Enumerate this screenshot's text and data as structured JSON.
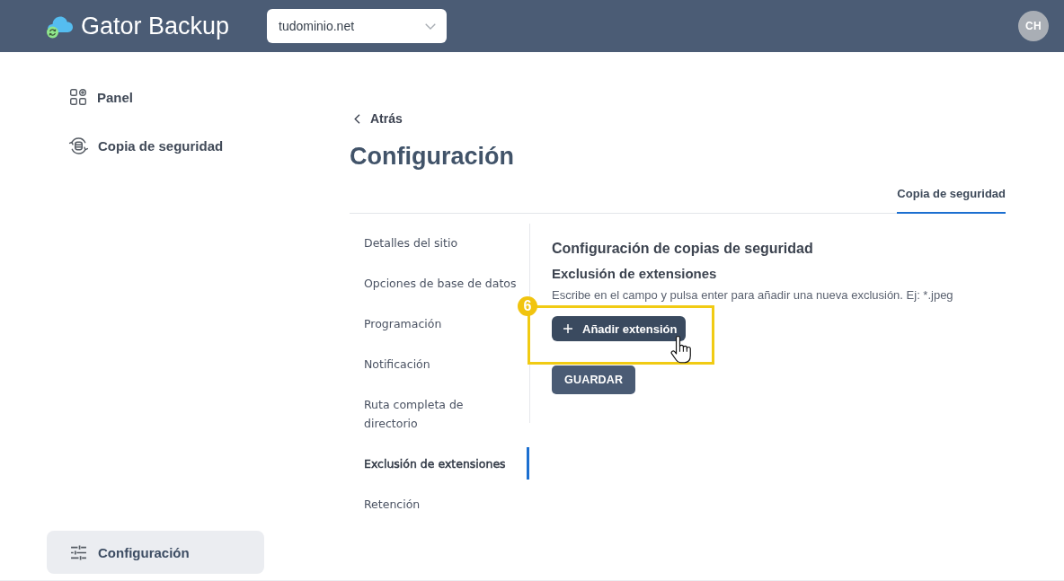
{
  "header": {
    "app_name": "Gator Backup",
    "domain_select": {
      "value": "tudominio.net"
    },
    "avatar": {
      "initials": "CH"
    }
  },
  "sidebar": {
    "items": [
      {
        "label": "Panel",
        "selected": false
      },
      {
        "label": "Copia de seguridad",
        "selected": false
      }
    ],
    "bottom_item": {
      "label": "Configuración",
      "selected": true
    }
  },
  "back_link": "Atrás",
  "page_title": "Configuración",
  "tabs": [
    {
      "label": "Copia de seguridad",
      "selected": true
    }
  ],
  "settings_menu": [
    {
      "label": "Detalles del sitio",
      "selected": false
    },
    {
      "label": "Opciones de base de datos",
      "selected": false
    },
    {
      "label": "Programación",
      "selected": false
    },
    {
      "label": "Notificación",
      "selected": false
    },
    {
      "label": "Ruta completa de directorio",
      "selected": false
    },
    {
      "label": "Exclusión de extensiones",
      "selected": true
    },
    {
      "label": "Retención",
      "selected": false
    }
  ],
  "panel": {
    "title": "Configuración de copias de seguridad",
    "section_title": "Exclusión de extensiones",
    "hint": "Escribe en el campo y pulsa enter para añadir una nueva exclusión. Ej: *.jpeg",
    "add_button": "Añadir extensión",
    "save_button": "GUARDAR"
  },
  "annotation": {
    "step": "6"
  }
}
